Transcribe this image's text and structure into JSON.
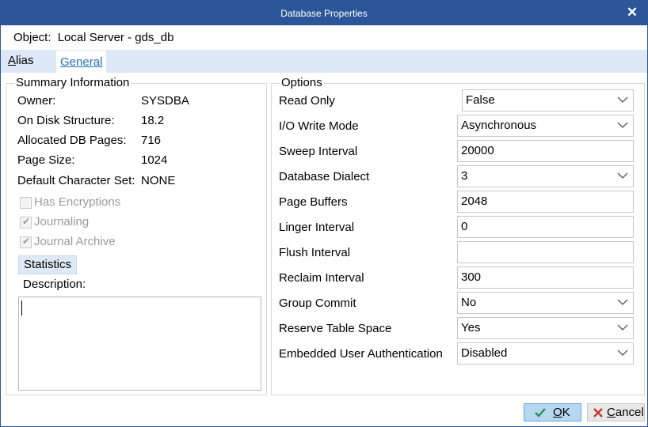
{
  "window": {
    "title": "Database Properties"
  },
  "object": {
    "label": "Object:",
    "value": "Local Server - gds_db"
  },
  "tabs": {
    "alias": {
      "first": "A",
      "rest": "lias"
    },
    "general": "General"
  },
  "summary": {
    "legend": "Summary Information",
    "owner_label": "Owner:",
    "owner": "SYSDBA",
    "ods_label": "On Disk Structure:",
    "ods": "18.2",
    "pages_label": "Allocated DB Pages:",
    "pages": "716",
    "page_size_label": "Page Size:",
    "page_size": "1024",
    "charset_label": "Default Character Set:",
    "charset": "NONE",
    "has_encryptions": "Has Encryptions",
    "journaling": "Journaling",
    "journal_archive": "Journal Archive",
    "statistics_button": "Statistics",
    "description_label": "Description:"
  },
  "options": {
    "legend": "Options",
    "read_only": {
      "label": "Read Only",
      "value": "False"
    },
    "io_write_mode": {
      "label": "I/O Write Mode",
      "value": "Asynchronous"
    },
    "sweep_interval": {
      "label": "Sweep Interval",
      "value": "20000"
    },
    "database_dialect": {
      "label": "Database Dialect",
      "value": "3"
    },
    "page_buffers": {
      "label": "Page Buffers",
      "value": "2048"
    },
    "linger_interval": {
      "label": "Linger Interval",
      "value": "0"
    },
    "flush_interval": {
      "label": "Flush Interval",
      "value": ""
    },
    "reclaim_interval": {
      "label": "Reclaim Interval",
      "value": "300"
    },
    "group_commit": {
      "label": "Group Commit",
      "value": "No"
    },
    "reserve_table_space": {
      "label": "Reserve Table Space",
      "value": "Yes"
    },
    "embedded_user_auth": {
      "label": "Embedded User Authentication",
      "value": "Disabled"
    }
  },
  "buttons": {
    "ok": {
      "first": "O",
      "rest": "K"
    },
    "cancel": {
      "first": "C",
      "rest": "ancel"
    }
  },
  "colors": {
    "titlebar": "#2b579a",
    "tab_strip": "#dde9f6",
    "accent": "#2070c0",
    "ok_check": "#2e8b57",
    "cancel_x": "#c0392b"
  }
}
